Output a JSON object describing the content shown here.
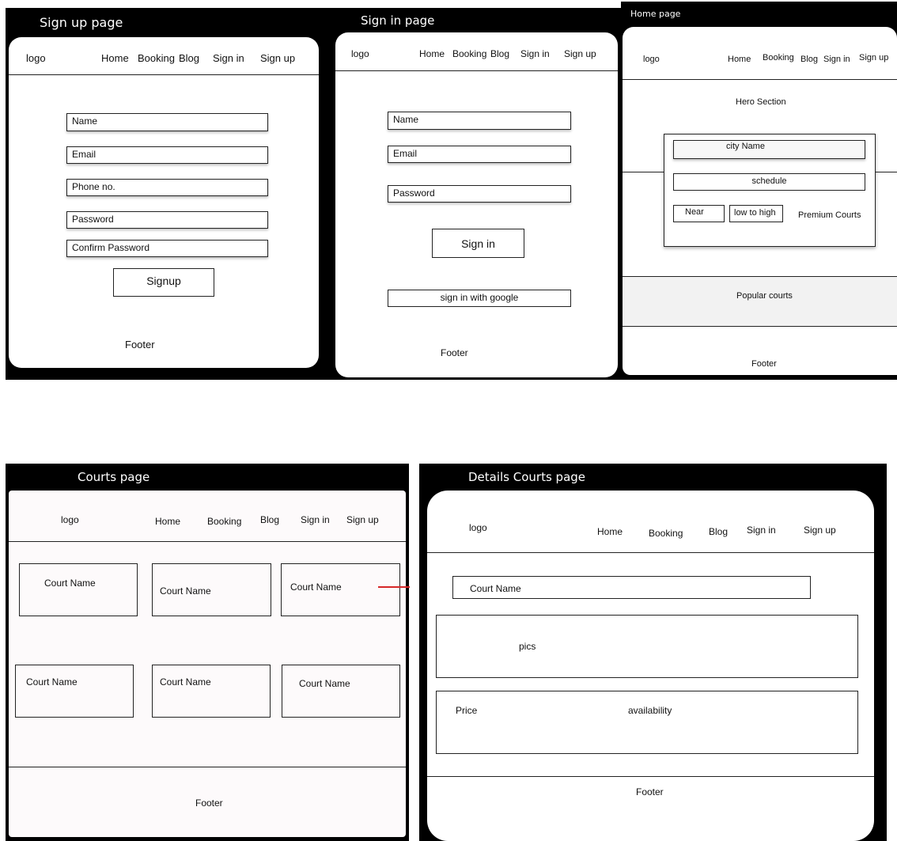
{
  "signup": {
    "title": "Sign up page",
    "nav": {
      "logo": "logo",
      "home": "Home",
      "booking": "Booking",
      "blog": "Blog",
      "signin": "Sign in",
      "signup": "Sign up"
    },
    "fields": {
      "name": "Name",
      "email": "Email",
      "phone": "Phone no.",
      "password": "Password",
      "confirm": "Confirm Password"
    },
    "button": "Signup",
    "footer": "Footer"
  },
  "signin": {
    "title": "Sign in page",
    "nav": {
      "logo": "logo",
      "home": "Home",
      "booking": "Booking",
      "blog": "Blog",
      "signin": "Sign in",
      "signup": "Sign up"
    },
    "fields": {
      "name": "Name",
      "email": "Email",
      "password": "Password"
    },
    "button": "Sign in",
    "google": "sign in with google",
    "footer": "Footer"
  },
  "home": {
    "title": "Home page",
    "nav": {
      "logo": "logo",
      "home": "Home",
      "booking": "Booking",
      "blog": "Blog",
      "signin": "Sign in",
      "signup": "Sign up"
    },
    "hero": "Hero Section",
    "city": "city Name",
    "schedule": "schedule",
    "near": "Near",
    "sort": "low to high",
    "premium": "Premium Courts",
    "popular": "Popular courts",
    "footer": "Footer"
  },
  "courts": {
    "title": "Courts page",
    "nav": {
      "logo": "logo",
      "home": "Home",
      "booking": "Booking",
      "blog": "Blog",
      "signin": "Sign in",
      "signup": "Sign up"
    },
    "cards": [
      "Court Name",
      "Court Name",
      "Court Name",
      "Court Name",
      "Court Name",
      "Court Name"
    ],
    "footer": "Footer"
  },
  "details": {
    "title": "Details Courts page",
    "nav": {
      "logo": "logo",
      "home": "Home",
      "booking": "Booking",
      "blog": "Blog",
      "signin": "Sign in",
      "signup": "Sign up"
    },
    "court_name": "Court Name",
    "pics": "pics",
    "price": "Price",
    "availability": "availability",
    "footer": "Footer"
  },
  "colors": {
    "arrow": "#d62728",
    "panel_bg": "#000000",
    "frame_bg": "#ffffff",
    "popular_bg": "#f2f2f2",
    "courts_bg": "#fdfafb"
  }
}
